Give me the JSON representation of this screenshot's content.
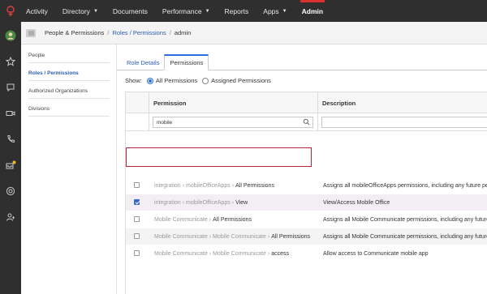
{
  "colors": {
    "nav_bg": "#2f2f2f",
    "accent_blue": "#2a6fdb",
    "highlight_red": "#c0213a",
    "active_tab_marker": "#d9302f"
  },
  "topnav": {
    "items": [
      {
        "label": "Activity",
        "dropdown": false
      },
      {
        "label": "Directory",
        "dropdown": true
      },
      {
        "label": "Documents",
        "dropdown": false
      },
      {
        "label": "Performance",
        "dropdown": true
      },
      {
        "label": "Reports",
        "dropdown": false
      },
      {
        "label": "Apps",
        "dropdown": true
      },
      {
        "label": "Admin",
        "dropdown": false,
        "active": true
      }
    ]
  },
  "rail": {
    "icons": [
      "avatar",
      "star-icon",
      "chat-icon",
      "video-icon",
      "phone-icon",
      "inbox-icon",
      "globe-icon",
      "user-settings-icon"
    ]
  },
  "breadcrumb": {
    "items": [
      "People & Permissions",
      "Roles / Permissions",
      "admin"
    ]
  },
  "subsidebar": {
    "items": [
      {
        "label": "People",
        "active": false
      },
      {
        "label": "Roles / Permissions",
        "active": true
      },
      {
        "label": "Authorized Organizations",
        "active": false
      },
      {
        "label": "Divisions",
        "active": false
      }
    ]
  },
  "tabs": [
    {
      "label": "Role Details",
      "active": false
    },
    {
      "label": "Permissions",
      "active": true
    }
  ],
  "show": {
    "label": "Show:",
    "options": [
      {
        "label": "All Permissions",
        "selected": true
      },
      {
        "label": "Assigned Permissions",
        "selected": false
      }
    ]
  },
  "table": {
    "headers": {
      "permission": "Permission",
      "description": "Description"
    },
    "filter": {
      "permission_value": "mobile",
      "description_value": ""
    },
    "rows": [
      {
        "path": [
          "integration",
          "mobileOfficeApps"
        ],
        "last": "All Permissions",
        "description": "Assigns all mobileOfficeApps permissions, including any future pe",
        "checked": false
      },
      {
        "path": [
          "integration",
          "mobileOfficeApps"
        ],
        "last": "View",
        "description": "View/Access Mobile Office",
        "checked": true
      },
      {
        "path": [
          "Mobile Communicate"
        ],
        "last": "All Permissions",
        "description": "Assigns all Mobile Communicate permissions, including any future",
        "checked": false
      },
      {
        "path": [
          "Mobile Communicate",
          "Mobile Communicate"
        ],
        "last": "All Permissions",
        "description": "Assigns all Mobile Communicate permissions, including any future",
        "checked": false
      },
      {
        "path": [
          "Mobile Communicate",
          "Mobile Communicate"
        ],
        "last": "access",
        "description": "Allow access to Communicate mobile app",
        "checked": false
      }
    ]
  }
}
